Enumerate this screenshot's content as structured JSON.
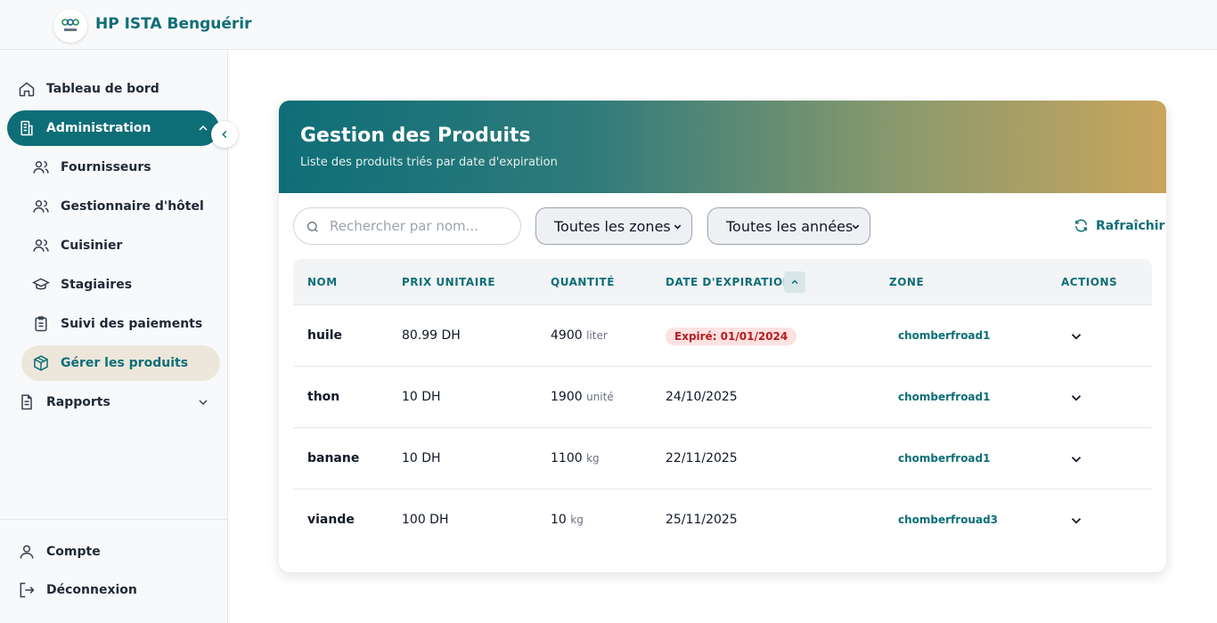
{
  "header": {
    "brand": "HP ISTA Benguérir",
    "logo_text": "ISTA"
  },
  "sidebar": {
    "items": [
      {
        "label": "Tableau de bord",
        "icon": "home-icon"
      },
      {
        "label": "Administration",
        "icon": "building-icon"
      },
      {
        "label": "Rapports",
        "icon": "report-icon"
      }
    ],
    "sub_items": [
      {
        "label": "Fournisseurs",
        "icon": "users-icon"
      },
      {
        "label": "Gestionnaire d'hôtel",
        "icon": "users-icon"
      },
      {
        "label": "Cuisinier",
        "icon": "users-icon"
      },
      {
        "label": "Stagiaires",
        "icon": "graduation-cap-icon"
      },
      {
        "label": "Suivi des paiements",
        "icon": "clipboard-icon"
      },
      {
        "label": "Gérer les produits",
        "icon": "package-icon"
      }
    ],
    "footer": [
      {
        "label": "Compte",
        "icon": "user-icon"
      },
      {
        "label": "Déconnexion",
        "icon": "logout-icon"
      }
    ]
  },
  "main": {
    "title": "Gestion des Produits",
    "subtitle": "Liste des produits triés par date d'expiration",
    "search_placeholder": "Rechercher par nom...",
    "zone_filter": "Toutes les zones",
    "year_filter": "Toutes les années",
    "refresh_label": "Rafraîchir",
    "columns": [
      "NOM",
      "PRIX UNITAIRE",
      "QUANTITÉ",
      "DATE D'EXPIRATION",
      "ZONE",
      "ACTIONS"
    ],
    "rows": [
      {
        "name": "huile",
        "price": "80.99 DH",
        "qty": "4900",
        "unit": "liter",
        "date": "Expiré: 01/01/2024",
        "expired": true,
        "zone": "chomberfroad1"
      },
      {
        "name": "thon",
        "price": "10 DH",
        "qty": "1900",
        "unit": "unité",
        "date": "24/10/2025",
        "expired": false,
        "zone": "chomberfroad1"
      },
      {
        "name": "banane",
        "price": "10 DH",
        "qty": "1100",
        "unit": "kg",
        "date": "22/11/2025",
        "expired": false,
        "zone": "chomberfroad1"
      },
      {
        "name": "viande",
        "price": "100 DH",
        "qty": "10",
        "unit": "kg",
        "date": "25/11/2025",
        "expired": false,
        "zone": "chomberfrouad3"
      }
    ]
  },
  "colors": {
    "accent": "#0e6e78",
    "accent_light": "#ede7db",
    "expired_bg": "#fde2e2",
    "expired_text": "#b91c1c"
  }
}
